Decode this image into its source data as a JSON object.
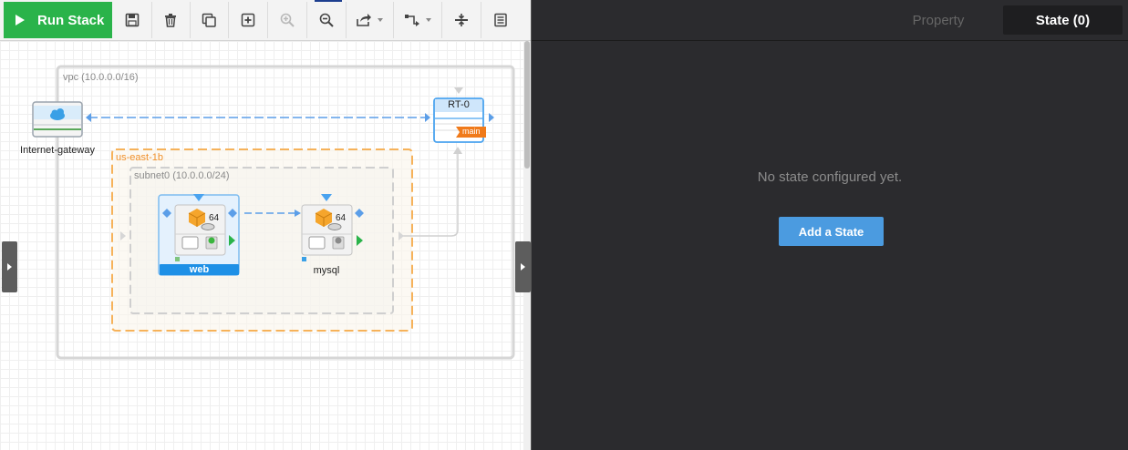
{
  "toolbar": {
    "run_label": "Run Stack",
    "icons": [
      "save-icon",
      "delete-icon",
      "duplicate-icon",
      "add-icon",
      "zoom-in-icon",
      "zoom-out-icon",
      "export-icon",
      "connection-style-icon",
      "collapse-icon",
      "list-icon"
    ]
  },
  "canvas": {
    "vpc_label": "vpc (10.0.0.0/16)",
    "az_label": "us-east-1b",
    "subnet_label": "subnet0 (10.0.0.0/24)",
    "igw_label": "Internet-gateway",
    "rt_label": "RT-0",
    "rt_badge": "main",
    "instances": [
      {
        "name": "web",
        "arch": "64",
        "selected": true
      },
      {
        "name": "mysql",
        "arch": "64",
        "selected": false
      }
    ],
    "colors": {
      "vpc": "#d6d6d6",
      "az": "#f6b25a",
      "subnet": "#cfcfcf",
      "connector": "#5b9ee8",
      "accent": "#1e90e6",
      "run": "#2ab34a"
    }
  },
  "panel": {
    "tabs": [
      {
        "label": "Property",
        "active": false
      },
      {
        "label": "State (0)",
        "active": true
      }
    ],
    "empty_message": "No state configured yet.",
    "add_button": "Add a State"
  }
}
